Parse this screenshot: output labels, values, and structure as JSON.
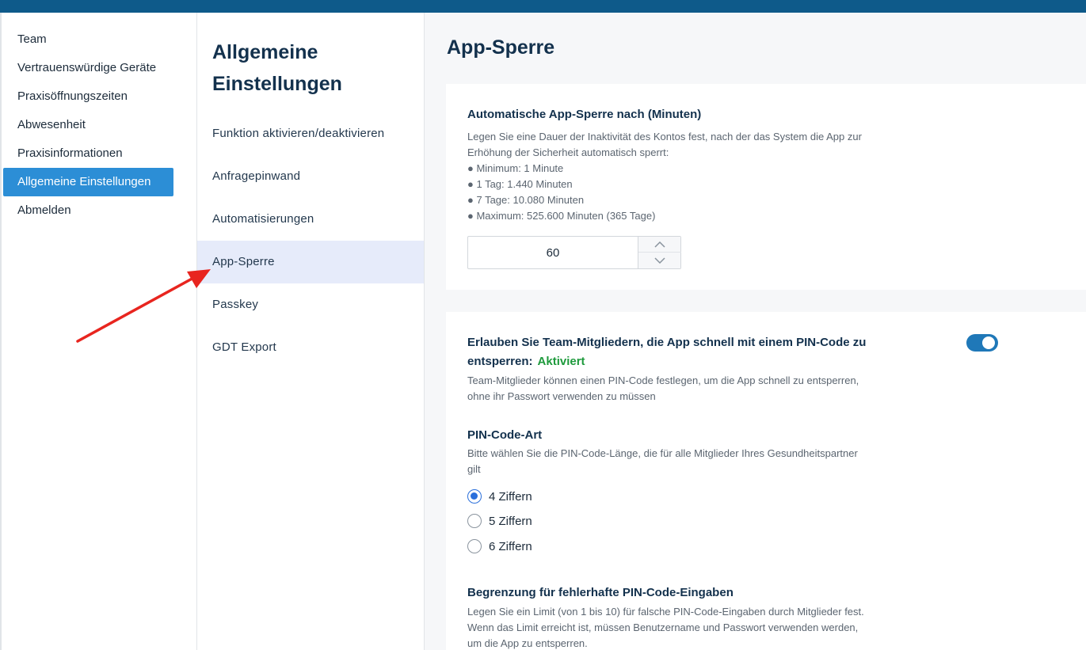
{
  "sidebar": {
    "items": [
      {
        "label": "Team",
        "active": false
      },
      {
        "label": "Vertrauenswürdige Geräte",
        "active": false
      },
      {
        "label": "Praxisöffnungszeiten",
        "active": false
      },
      {
        "label": "Abwesenheit",
        "active": false
      },
      {
        "label": "Praxisinformationen",
        "active": false
      },
      {
        "label": "Allgemeine Einstellungen",
        "active": true
      },
      {
        "label": "Abmelden",
        "active": false
      }
    ]
  },
  "subnav": {
    "title_line1": "Allgemeine",
    "title_line2": "Einstellungen",
    "items": [
      {
        "label": "Funktion aktivieren/deaktivieren",
        "active": false
      },
      {
        "label": "Anfragepinwand",
        "active": false
      },
      {
        "label": "Automatisierungen",
        "active": false
      },
      {
        "label": "App-Sperre",
        "active": true
      },
      {
        "label": "Passkey",
        "active": false
      },
      {
        "label": "GDT Export",
        "active": false
      }
    ]
  },
  "main": {
    "title": "App-Sperre",
    "autolock": {
      "heading": "Automatische App-Sperre nach (Minuten)",
      "description_line1": "Legen Sie eine Dauer der Inaktivität des Kontos fest, nach der das System die App zur",
      "description_line2": "Erhöhung der Sicherheit automatisch sperrt:",
      "bullets": [
        "● Minimum: 1 Minute",
        "● 1 Tag: 1.440 Minuten",
        "● 7 Tage: 10.080 Minuten",
        "● Maximum: 525.600 Minuten (365 Tage)"
      ],
      "value": "60"
    },
    "pin": {
      "heading_line1": "Erlauben Sie Team-Mitgliedern, die App schnell mit einem PIN-Code zu",
      "heading_line2": "entsperren:",
      "status": "Aktiviert",
      "toggle_on": true,
      "description_line1": "Team-Mitglieder können einen PIN-Code festlegen, um die App schnell zu entsperren,",
      "description_line2": "ohne ihr Passwort verwenden zu müssen",
      "type_heading": "PIN-Code-Art",
      "type_description_line1": "Bitte wählen Sie die PIN-Code-Länge, die für alle Mitglieder Ihres Gesundheitspartner",
      "type_description_line2": "gilt",
      "options": [
        {
          "label": "4 Ziffern",
          "checked": true
        },
        {
          "label": "5 Ziffern",
          "checked": false
        },
        {
          "label": "6 Ziffern",
          "checked": false
        }
      ],
      "limit_heading": "Begrenzung für fehlerhafte PIN-Code-Eingaben",
      "limit_description_line1": "Legen Sie ein Limit (von 1 bis 10) für falsche PIN-Code-Eingaben durch Mitglieder fest.",
      "limit_description_line2": "Wenn das Limit erreicht ist, müssen Benutzername und Passwort verwenden werden,",
      "limit_description_line3": "um die App zu entsperren."
    }
  },
  "colors": {
    "topbar": "#0e5a8a",
    "sidebar_active": "#2c8ed6",
    "subnav_active": "#e6ebfa",
    "toggle": "#1f78b8",
    "status_ok": "#1e9a3c",
    "annotation_arrow": "#e8251f"
  }
}
